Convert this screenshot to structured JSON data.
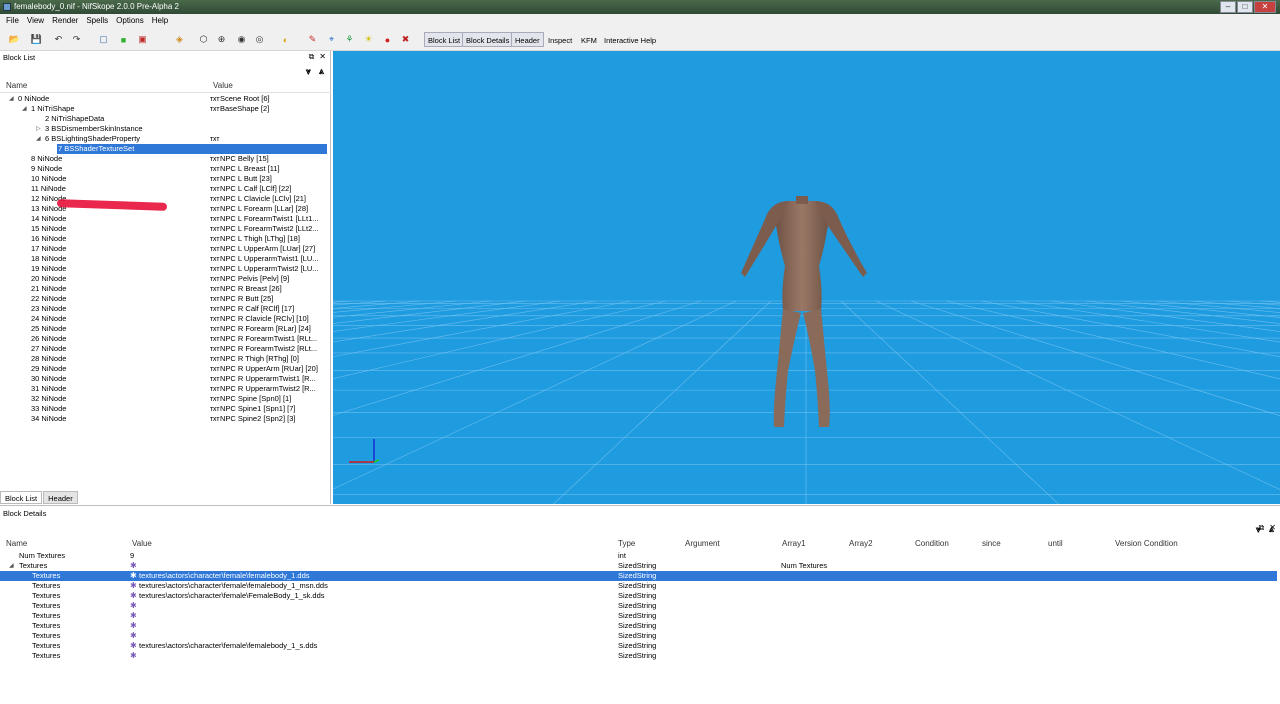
{
  "window": {
    "title": "femalebody_0.nif - NifSkope 2.0.0 Pre-Alpha 2"
  },
  "menu": [
    "File",
    "View",
    "Render",
    "Spells",
    "Options",
    "Help"
  ],
  "toolbar": {
    "icons": [
      "open-icon",
      "save-icon",
      "undo-icon",
      "redo-icon",
      "view-box-icon",
      "view-green-icon",
      "view-red-icon",
      "view-cube-icon",
      "texture-icon",
      "eye-icon",
      "eye-alt-icon",
      "frame-icon",
      "light-icon",
      "select-icon",
      "axes-icon",
      "tree-icon",
      "sun-icon",
      "pin-icon",
      "no-anim-icon"
    ],
    "text_buttons": [
      "Block List",
      "Block Details",
      "Header",
      "Inspect",
      "KFM",
      "Interactive Help"
    ]
  },
  "block_list": {
    "title": "Block List",
    "columns": {
      "name": "Name",
      "value": "Value"
    },
    "rows": [
      {
        "name": "0 NiNode",
        "value": "Scene Root [6]",
        "depth": 0,
        "exp": "open",
        "txt": true
      },
      {
        "name": "1 NiTriShape",
        "value": "BaseShape [2]",
        "depth": 1,
        "exp": "open",
        "txt": true
      },
      {
        "name": "2 NiTriShapeData",
        "value": "",
        "depth": 2,
        "exp": "",
        "txt": false
      },
      {
        "name": "3 BSDismemberSkinInstance",
        "value": "",
        "depth": 2,
        "exp": "closed",
        "txt": false
      },
      {
        "name": "6 BSLightingShaderProperty",
        "value": "",
        "depth": 2,
        "exp": "open",
        "txt": true
      },
      {
        "name": "7 BSShaderTextureSet",
        "value": "",
        "depth": 3,
        "exp": "",
        "txt": false,
        "selected": true
      },
      {
        "name": "8 NiNode",
        "value": "NPC Belly [15]",
        "depth": 1,
        "exp": "",
        "txt": true
      },
      {
        "name": "9 NiNode",
        "value": "NPC L Breast [11]",
        "depth": 1,
        "exp": "",
        "txt": true
      },
      {
        "name": "10 NiNode",
        "value": "NPC L Butt [23]",
        "depth": 1,
        "exp": "",
        "txt": true
      },
      {
        "name": "11 NiNode",
        "value": "NPC L Calf [LClf] [22]",
        "depth": 1,
        "exp": "",
        "txt": true
      },
      {
        "name": "12 NiNode",
        "value": "NPC L Clavicle [LClv] [21]",
        "depth": 1,
        "exp": "",
        "txt": true
      },
      {
        "name": "13 NiNode",
        "value": "NPC L Forearm [LLar] [28]",
        "depth": 1,
        "exp": "",
        "txt": true
      },
      {
        "name": "14 NiNode",
        "value": "NPC L ForearmTwist1 [LLt1...",
        "depth": 1,
        "exp": "",
        "txt": true
      },
      {
        "name": "15 NiNode",
        "value": "NPC L ForearmTwist2 [LLt2...",
        "depth": 1,
        "exp": "",
        "txt": true
      },
      {
        "name": "16 NiNode",
        "value": "NPC L Thigh [LThg] [18]",
        "depth": 1,
        "exp": "",
        "txt": true
      },
      {
        "name": "17 NiNode",
        "value": "NPC L UpperArm [LUar] [27]",
        "depth": 1,
        "exp": "",
        "txt": true
      },
      {
        "name": "18 NiNode",
        "value": "NPC L UpperarmTwist1 [LU...",
        "depth": 1,
        "exp": "",
        "txt": true
      },
      {
        "name": "19 NiNode",
        "value": "NPC L UpperarmTwist2 [LU...",
        "depth": 1,
        "exp": "",
        "txt": true
      },
      {
        "name": "20 NiNode",
        "value": "NPC Pelvis [Pelv] [9]",
        "depth": 1,
        "exp": "",
        "txt": true
      },
      {
        "name": "21 NiNode",
        "value": "NPC R Breast [26]",
        "depth": 1,
        "exp": "",
        "txt": true
      },
      {
        "name": "22 NiNode",
        "value": "NPC R Butt [25]",
        "depth": 1,
        "exp": "",
        "txt": true
      },
      {
        "name": "23 NiNode",
        "value": "NPC R Calf [RClf] [17]",
        "depth": 1,
        "exp": "",
        "txt": true
      },
      {
        "name": "24 NiNode",
        "value": "NPC R Clavicle [RClv] [10]",
        "depth": 1,
        "exp": "",
        "txt": true
      },
      {
        "name": "25 NiNode",
        "value": "NPC R Forearm [RLar] [24]",
        "depth": 1,
        "exp": "",
        "txt": true
      },
      {
        "name": "26 NiNode",
        "value": "NPC R ForearmTwist1 [RLt...",
        "depth": 1,
        "exp": "",
        "txt": true
      },
      {
        "name": "27 NiNode",
        "value": "NPC R ForearmTwist2 [RLt...",
        "depth": 1,
        "exp": "",
        "txt": true
      },
      {
        "name": "28 NiNode",
        "value": "NPC R Thigh [RThg] [0]",
        "depth": 1,
        "exp": "",
        "txt": true
      },
      {
        "name": "29 NiNode",
        "value": "NPC R UpperArm [RUar] [20]",
        "depth": 1,
        "exp": "",
        "txt": true
      },
      {
        "name": "30 NiNode",
        "value": "NPC R UpperarmTwist1 [R...",
        "depth": 1,
        "exp": "",
        "txt": true
      },
      {
        "name": "31 NiNode",
        "value": "NPC R UpperarmTwist2 [R...",
        "depth": 1,
        "exp": "",
        "txt": true
      },
      {
        "name": "32 NiNode",
        "value": "NPC Spine [Spn0] [1]",
        "depth": 1,
        "exp": "",
        "txt": true
      },
      {
        "name": "33 NiNode",
        "value": "NPC Spine1 [Spn1] [7]",
        "depth": 1,
        "exp": "",
        "txt": true
      },
      {
        "name": "34 NiNode",
        "value": "NPC Spine2 [Spn2] [3]",
        "depth": 1,
        "exp": "",
        "txt": true
      }
    ],
    "tabs": [
      "Block List",
      "Header"
    ]
  },
  "block_details": {
    "title": "Block Details",
    "columns": [
      "Name",
      "Value",
      "Type",
      "Argument",
      "Array1",
      "Array2",
      "Condition",
      "since",
      "until",
      "Version Condition"
    ],
    "rows": [
      {
        "name": "Num Textures",
        "value": "9",
        "type": "int",
        "array1": "",
        "indent": 1,
        "icon": false,
        "exp": ""
      },
      {
        "name": "Textures",
        "value": "",
        "type": "SizedString",
        "array1": "Num Textures",
        "indent": 1,
        "icon": true,
        "exp": "open"
      },
      {
        "name": "Textures",
        "value": "textures\\actors\\character\\female\\femalebody_1.dds",
        "type": "SizedString",
        "array1": "",
        "indent": 2,
        "icon": true,
        "selected": true
      },
      {
        "name": "Textures",
        "value": "textures\\actors\\character\\female\\femalebody_1_msn.dds",
        "type": "SizedString",
        "array1": "",
        "indent": 2,
        "icon": true
      },
      {
        "name": "Textures",
        "value": "textures\\actors\\character\\female\\FemaleBody_1_sk.dds",
        "type": "SizedString",
        "array1": "",
        "indent": 2,
        "icon": true
      },
      {
        "name": "Textures",
        "value": "",
        "type": "SizedString",
        "array1": "",
        "indent": 2,
        "icon": true
      },
      {
        "name": "Textures",
        "value": "",
        "type": "SizedString",
        "array1": "",
        "indent": 2,
        "icon": true
      },
      {
        "name": "Textures",
        "value": "",
        "type": "SizedString",
        "array1": "",
        "indent": 2,
        "icon": true
      },
      {
        "name": "Textures",
        "value": "",
        "type": "SizedString",
        "array1": "",
        "indent": 2,
        "icon": true
      },
      {
        "name": "Textures",
        "value": "textures\\actors\\character\\female\\femalebody_1_s.dds",
        "type": "SizedString",
        "array1": "",
        "indent": 2,
        "icon": true
      },
      {
        "name": "Textures",
        "value": "",
        "type": "SizedString",
        "array1": "",
        "indent": 2,
        "icon": true
      }
    ]
  },
  "colors": {
    "viewport_bg": "#1f9be0",
    "selection": "#2f78d8",
    "grid": "#7ec8f2",
    "body": "#8a6a58"
  }
}
